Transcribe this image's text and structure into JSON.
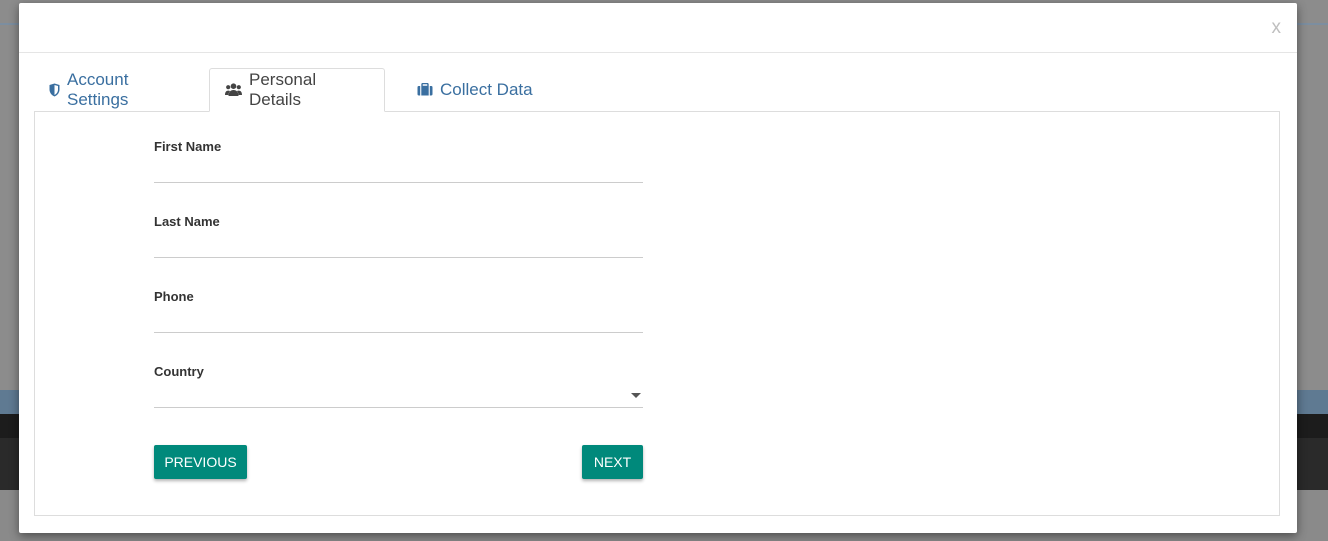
{
  "modal": {
    "close_label": "x"
  },
  "tabs": [
    {
      "label": "Account Settings",
      "icon": "shield-icon",
      "active": false
    },
    {
      "label": "Personal Details",
      "icon": "users-icon",
      "active": true
    },
    {
      "label": "Collect Data",
      "icon": "briefcase-icon",
      "active": false
    }
  ],
  "form": {
    "fields": [
      {
        "label": "First Name",
        "value": ""
      },
      {
        "label": "Last Name",
        "value": ""
      },
      {
        "label": "Phone",
        "value": ""
      },
      {
        "label": "Country",
        "value": ""
      }
    ],
    "previous_label": "PREVIOUS",
    "next_label": "NEXT"
  },
  "colors": {
    "accent": "#00897b",
    "tab_link": "#3a6fa0",
    "overlay": "#8a8a8a"
  }
}
